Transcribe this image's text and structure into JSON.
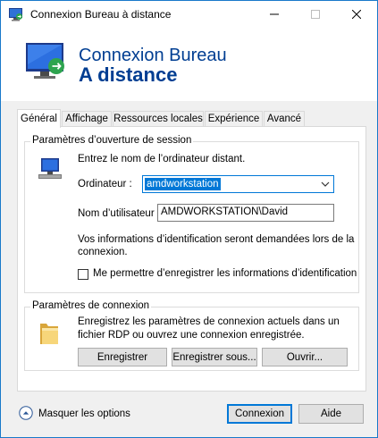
{
  "window": {
    "title": "Connexion Bureau à distance",
    "icon": "remote-desktop-icon",
    "controls": {
      "minimize": "—",
      "maximize": "☐",
      "close": "✕"
    }
  },
  "banner": {
    "line1": "Connexion Bureau",
    "line2": "A distance",
    "color": "#003e92"
  },
  "tabs": [
    {
      "label": "Général",
      "active": true
    },
    {
      "label": "Affichage"
    },
    {
      "label": "Ressources locales"
    },
    {
      "label": "Expérience"
    },
    {
      "label": "Avancé"
    }
  ],
  "logon": {
    "group_title": "Paramètres d’ouverture de session",
    "instruction": "Entrez le nom de l’ordinateur distant.",
    "computer_label": "Ordinateur :",
    "computer_value": "amdworkstation",
    "username_label": "Nom d’utilisateur :",
    "username_value": "AMDWORKSTATION\\David",
    "info_line1": "Vos informations d’identification seront demandées lors de la",
    "info_line2": "connexion.",
    "remember_label": "Me permettre d’enregistrer les informations d’identification",
    "remember_checked": false
  },
  "connection": {
    "group_title": "Paramètres de connexion",
    "desc_line1": "Enregistrez les paramètres de connexion actuels dans un",
    "desc_line2": "fichier RDP ou ouvrez une connexion enregistrée.",
    "save_label": "Enregistrer",
    "save_as_label": "Enregistrer sous...",
    "open_label": "Ouvrir..."
  },
  "footer": {
    "toggle_label": "Masquer les options",
    "connect_label": "Connexion",
    "help_label": "Aide"
  },
  "colors": {
    "accent": "#0078d7",
    "window_border": "#1979ca",
    "banner_text": "#003e92"
  }
}
